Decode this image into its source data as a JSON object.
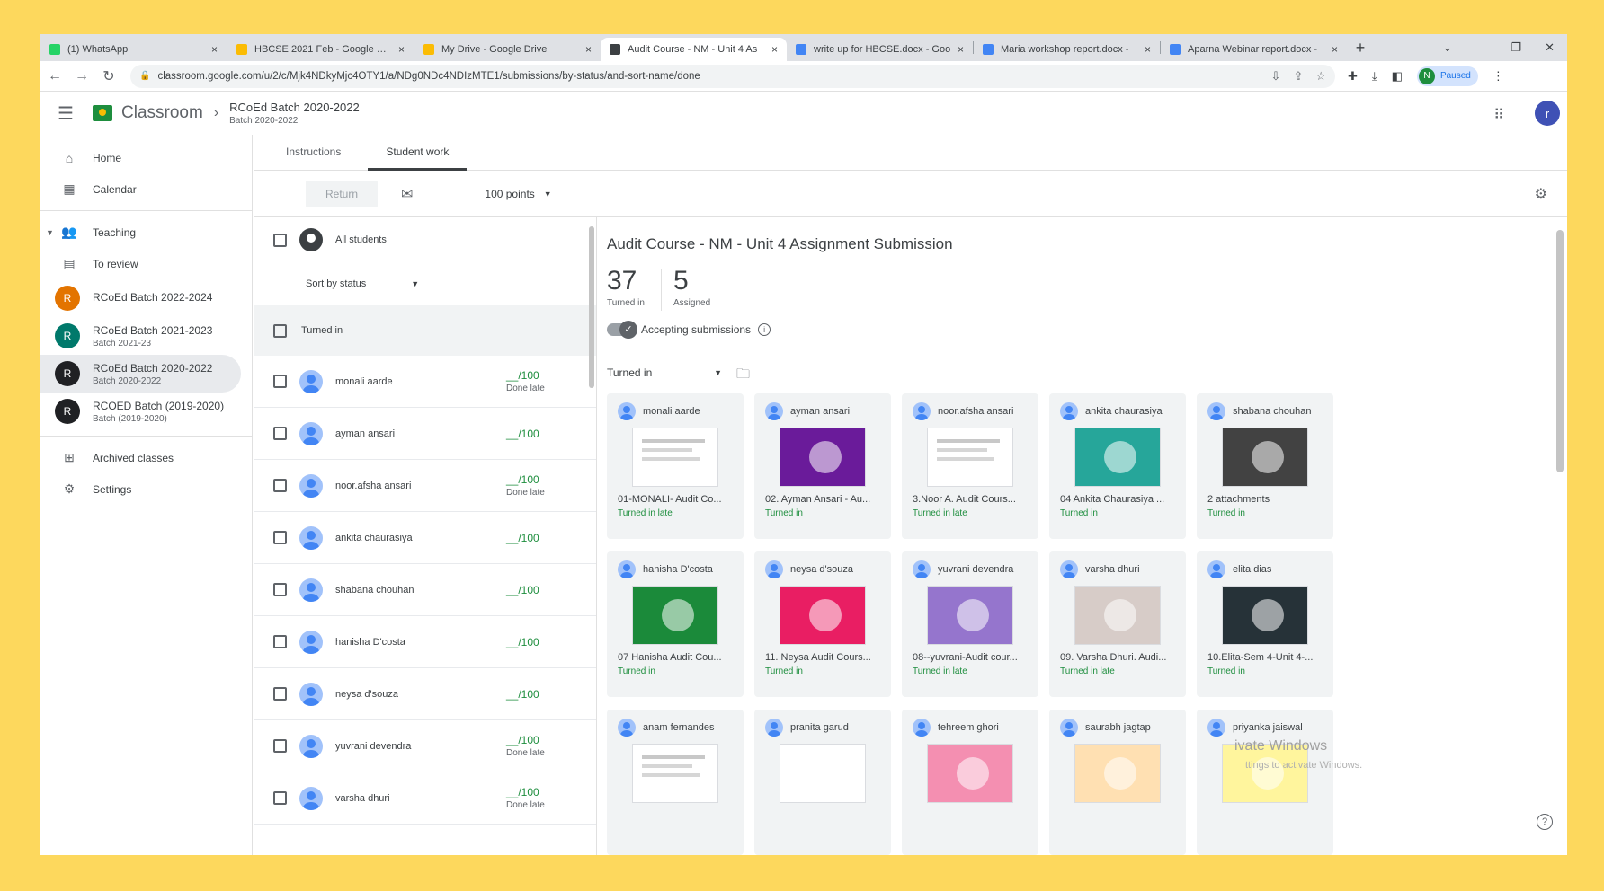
{
  "browser": {
    "tabs": [
      {
        "label": "(1) WhatsApp",
        "color": "#25d366"
      },
      {
        "label": "HBCSE 2021 Feb - Google Drive",
        "color": "#fbbc04"
      },
      {
        "label": "My Drive - Google Drive",
        "color": "#fbbc04"
      },
      {
        "label": "Audit Course - NM - Unit 4 As",
        "color": "#3c4043"
      },
      {
        "label": "write up for HBCSE.docx - Goo",
        "color": "#4285f4"
      },
      {
        "label": "Maria workshop report.docx -",
        "color": "#4285f4"
      },
      {
        "label": "Aparna Webinar report.docx -",
        "color": "#4285f4"
      }
    ],
    "url": "classroom.google.com/u/2/c/Mjk4NDkyMjc4OTY1/a/NDg0NDc4NDIzMTE1/submissions/by-status/and-sort-name/done",
    "profile_status": "Paused",
    "profile_initial": "N"
  },
  "app": {
    "name": "Classroom",
    "class_title": "RCoEd Batch 2020-2022",
    "class_subtitle": "Batch 2020-2022",
    "user_initial": "r"
  },
  "sidebar": {
    "home": "Home",
    "calendar": "Calendar",
    "teaching": "Teaching",
    "to_review": "To review",
    "classes": [
      {
        "initial": "R",
        "title": "RCoEd Batch 2022-2024",
        "subtitle": "",
        "color": "#e37400"
      },
      {
        "initial": "R",
        "title": "RCoEd Batch 2021-2023",
        "subtitle": "Batch 2021-23",
        "color": "#00796b"
      },
      {
        "initial": "R",
        "title": "RCoEd Batch 2020-2022",
        "subtitle": "Batch 2020-2022",
        "color": "#202124"
      },
      {
        "initial": "R",
        "title": "RCOED Batch (2019-2020)",
        "subtitle": "Batch (2019-2020)",
        "color": "#202124"
      }
    ],
    "archived": "Archived classes",
    "settings": "Settings"
  },
  "tabs": {
    "instructions": "Instructions",
    "student_work": "Student work"
  },
  "toolbar": {
    "return": "Return",
    "points": "100 points"
  },
  "list": {
    "all_students": "All students",
    "sort": "Sort by status",
    "section": "Turned in",
    "students": [
      {
        "name": "monali aarde",
        "grade": "__/100",
        "late": "Done late"
      },
      {
        "name": "ayman ansari",
        "grade": "__/100",
        "late": ""
      },
      {
        "name": "noor.afsha ansari",
        "grade": "__/100",
        "late": "Done late"
      },
      {
        "name": "ankita chaurasiya",
        "grade": "__/100",
        "late": ""
      },
      {
        "name": "shabana chouhan",
        "grade": "__/100",
        "late": ""
      },
      {
        "name": "hanisha D'costa",
        "grade": "__/100",
        "late": ""
      },
      {
        "name": "neysa d'souza",
        "grade": "__/100",
        "late": ""
      },
      {
        "name": "yuvrani devendra",
        "grade": "__/100",
        "late": "Done late"
      },
      {
        "name": "varsha dhuri",
        "grade": "__/100",
        "late": "Done late"
      }
    ]
  },
  "detail": {
    "title": "Audit Course - NM - Unit 4 Assignment Submission",
    "turned_in_count": "37",
    "turned_in_label": "Turned in",
    "assigned_count": "5",
    "assigned_label": "Assigned",
    "accepting": "Accepting submissions",
    "filter": "Turned in",
    "cards": [
      {
        "name": "monali aarde",
        "file": "01-MONALI- Audit Co...",
        "status": "Turned in late",
        "thumb": "doc"
      },
      {
        "name": "ayman ansari",
        "file": "02. Ayman Ansari - Au...",
        "status": "Turned in",
        "thumb": "#6a1b9a"
      },
      {
        "name": "noor.afsha ansari",
        "file": "3.Noor A. Audit Cours...",
        "status": "Turned in late",
        "thumb": "doc"
      },
      {
        "name": "ankita chaurasiya",
        "file": "04 Ankita Chaurasiya ...",
        "status": "Turned in",
        "thumb": "#26a69a"
      },
      {
        "name": "shabana chouhan",
        "file": "2 attachments",
        "status": "Turned in",
        "thumb": "#424242"
      },
      {
        "name": "hanisha D'costa",
        "file": "07 Hanisha Audit Cou...",
        "status": "Turned in",
        "thumb": "#1b8a3a"
      },
      {
        "name": "neysa d'souza",
        "file": "11. Neysa Audit Cours...",
        "status": "Turned in",
        "thumb": "#e91e63"
      },
      {
        "name": "yuvrani devendra",
        "file": "08--yuvrani-Audit cour...",
        "status": "Turned in late",
        "thumb": "#9575cd"
      },
      {
        "name": "varsha dhuri",
        "file": "09. Varsha Dhuri. Audi...",
        "status": "Turned in late",
        "thumb": "#d7ccc8"
      },
      {
        "name": "elita dias",
        "file": "10.Elita-Sem 4-Unit 4-...",
        "status": "Turned in",
        "thumb": "#263238"
      },
      {
        "name": "anam fernandes",
        "file": "",
        "status": "",
        "thumb": "doc"
      },
      {
        "name": "pranita garud",
        "file": "",
        "status": "",
        "thumb": "blank"
      },
      {
        "name": "tehreem ghori",
        "file": "",
        "status": "",
        "thumb": "#f48fb1"
      },
      {
        "name": "saurabh jagtap",
        "file": "",
        "status": "",
        "thumb": "#ffe0b2"
      },
      {
        "name": "priyanka jaiswal",
        "file": "",
        "status": "",
        "thumb": "#fff59d"
      }
    ],
    "watermark": "ivate Windows",
    "watermark_sub": "ttings to activate Windows."
  }
}
